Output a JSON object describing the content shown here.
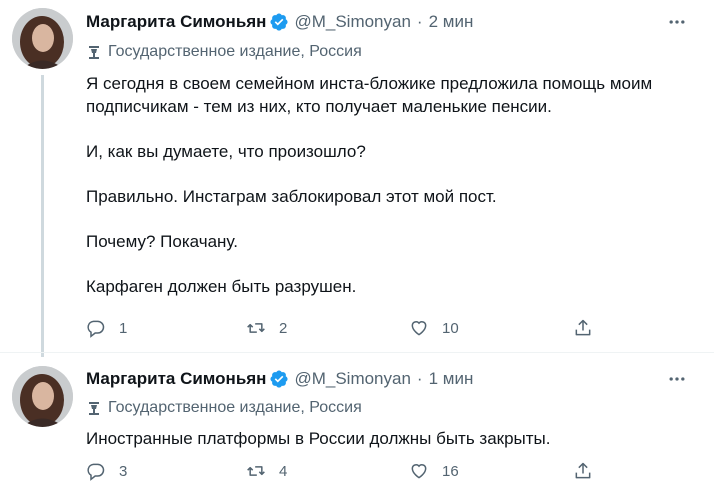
{
  "tweets": [
    {
      "author_name": "Маргарита Симоньян",
      "handle": "@M_Simonyan",
      "separator": "·",
      "time": "2 мин",
      "label": "Государственное издание, Россия",
      "paragraphs": [
        "Я сегодня в своем семейном инста-бложике предложила помощь моим подписчикам - тем из них, кто получает маленькие пенсии.",
        "И, как вы думаете, что произошло?",
        "Правильно. Инстаграм заблокировал этот мой пост.",
        "Почему? Покачану.",
        "Карфаген должен быть разрушен."
      ],
      "replies": "1",
      "retweets": "2",
      "likes": "10"
    },
    {
      "author_name": "Маргарита Симоньян",
      "handle": "@M_Simonyan",
      "separator": "·",
      "time": "1 мин",
      "label": "Государственное издание, Россия",
      "paragraphs": [
        "Иностранные платформы в России должны быть закрыты."
      ],
      "replies": "3",
      "retweets": "4",
      "likes": "16"
    }
  ],
  "icons": {
    "verified": "verified-badge-icon",
    "more": "more-dots-icon",
    "state_media": "lectern-icon",
    "reply": "reply-icon",
    "retweet": "retweet-icon",
    "like": "heart-icon",
    "share": "share-icon"
  },
  "colors": {
    "verified_blue": "#1d9bf0",
    "secondary_text": "#536471",
    "thread_line": "#cfd9de"
  }
}
